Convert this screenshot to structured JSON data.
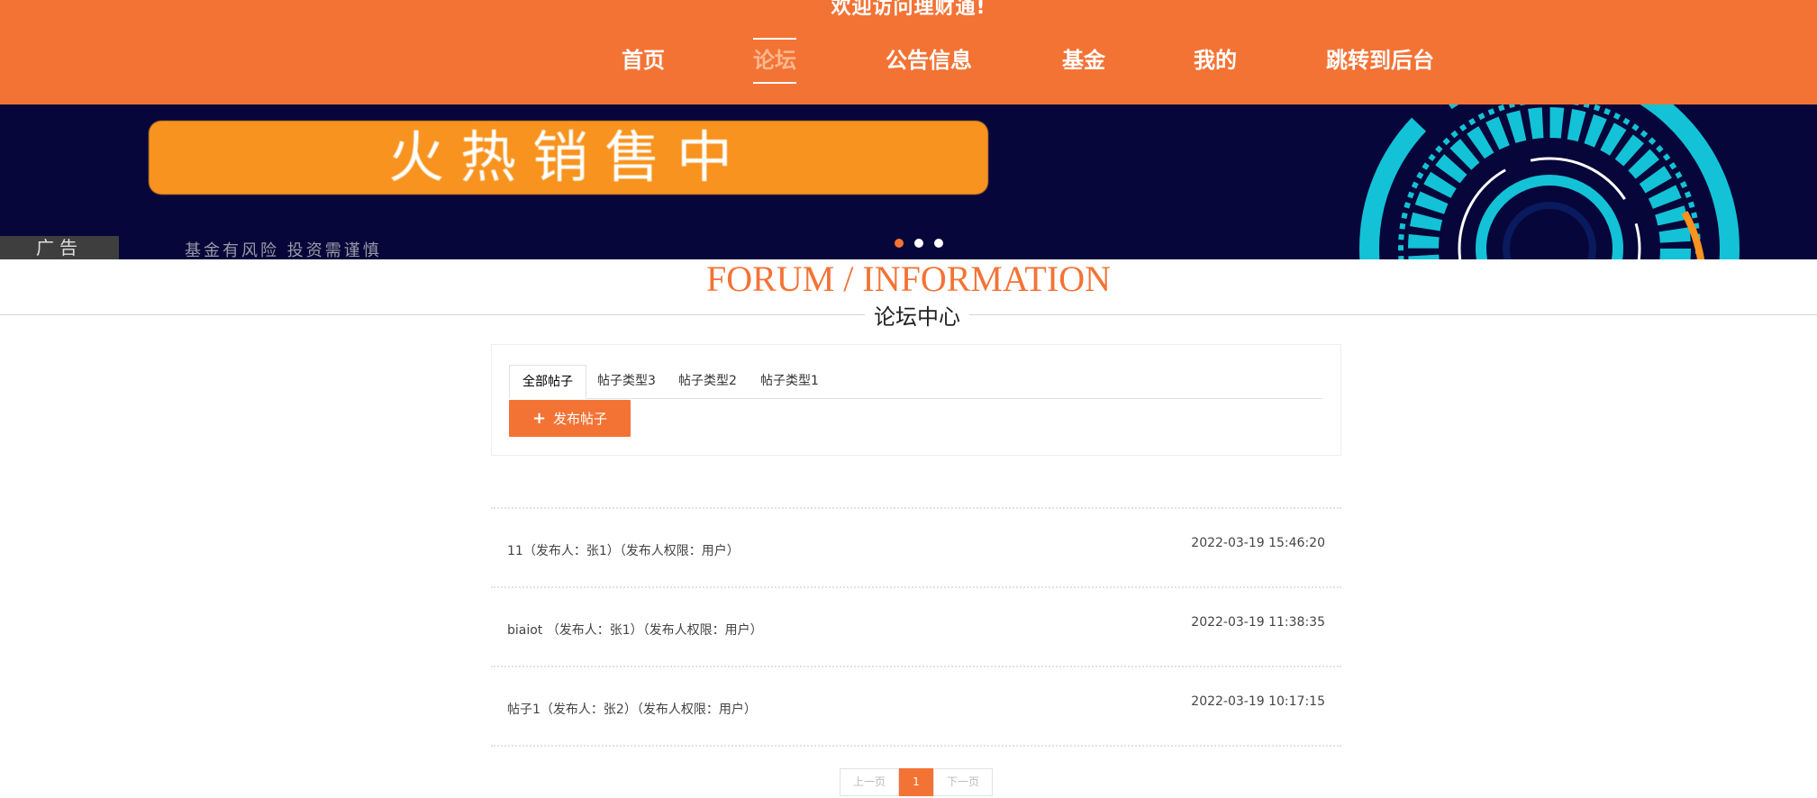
{
  "header": {
    "welcome": "欢迎访问理财通!"
  },
  "nav": {
    "items": [
      {
        "label": "首页",
        "active": false
      },
      {
        "label": "论坛",
        "active": true
      },
      {
        "label": "公告信息",
        "active": false
      },
      {
        "label": "基金",
        "active": false
      },
      {
        "label": "我的",
        "active": false
      },
      {
        "label": "跳转到后台",
        "active": false
      }
    ]
  },
  "banner": {
    "headline": "火热销售中",
    "ad_tag": "广告",
    "risk_text": "基金有风险 投资需谨慎",
    "active_dot": 0,
    "dot_count": 3
  },
  "section": {
    "title_en": "FORUM / INFORMATION",
    "title_cn": "论坛中心"
  },
  "forum": {
    "tabs": [
      "全部帖子",
      "帖子类型3",
      "帖子类型2",
      "帖子类型1"
    ],
    "publish_label": "发布帖子",
    "posts": [
      {
        "title": "11（发布人：张1）（发布人权限：用户）",
        "time": "2022-03-19 15:46:20"
      },
      {
        "title": "biaiot （发布人：张1）（发布人权限：用户）",
        "time": "2022-03-19 11:38:35"
      },
      {
        "title": "帖子1（发布人：张2）（发布人权限：用户）",
        "time": "2022-03-19 10:17:15"
      }
    ]
  },
  "pagination": {
    "prev": "上一页",
    "current": "1",
    "next": "下一页"
  },
  "colors": {
    "brand": "#f37335",
    "banner_bg": "#06063a",
    "banner_accent": "#13c2d6"
  }
}
